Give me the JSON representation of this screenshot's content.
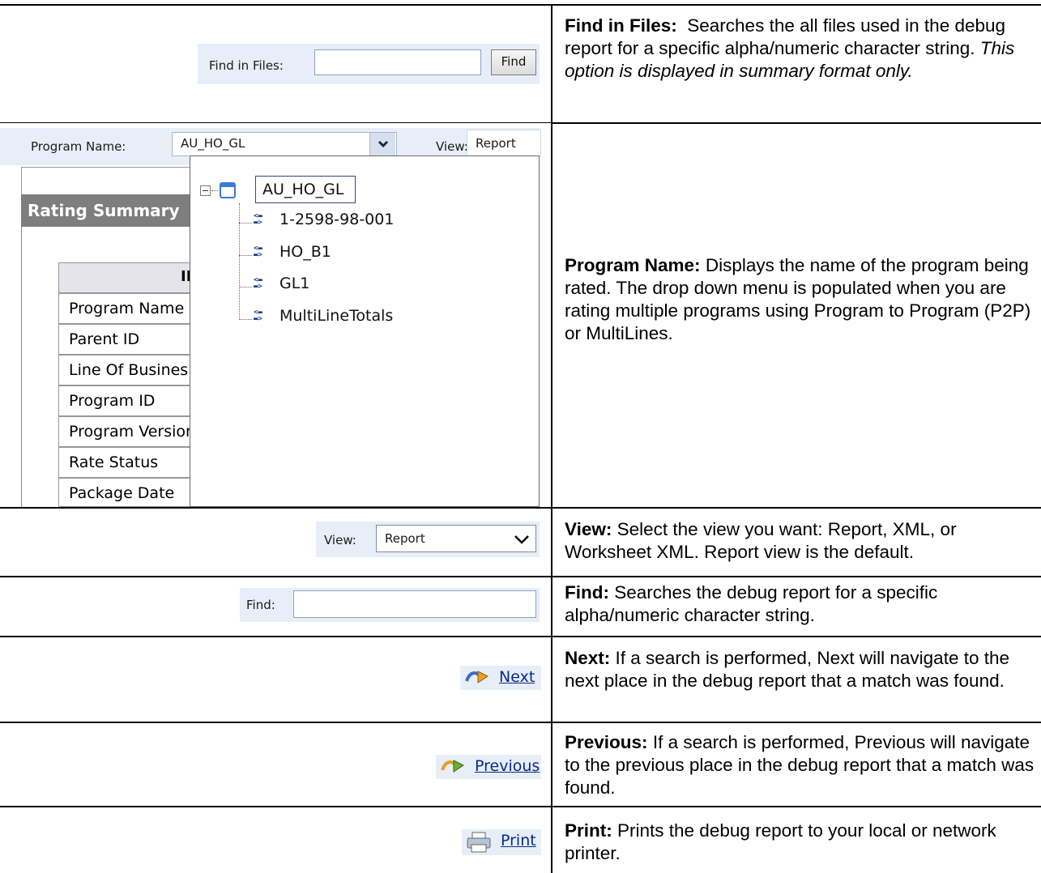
{
  "rows": {
    "find_in_files": {
      "label": "Find in Files:",
      "button": "Find",
      "desc_title": "Find in Files:",
      "desc_body": "Searches the all files used in the debug report for a specific alpha/numeric character string.",
      "desc_note": "This option is displayed in summary format only."
    },
    "program_name": {
      "label": "Program Name:",
      "value": "AU_HO_GL",
      "view_label": "View:",
      "view_value": "Report",
      "rating_summary": "Rating Summary",
      "grid_header_fragment": "II",
      "grid_rows": [
        "Program Name",
        "Parent ID",
        "Line Of Busines",
        "Program ID",
        "Program Versior",
        "Rate Status",
        "Package Date"
      ],
      "tree_root": "AU_HO_GL",
      "tree_children": [
        "1-2598-98-001",
        "HO_B1",
        "GL1",
        "MultiLineTotals"
      ],
      "desc_title": "Program Name:",
      "desc_body": "Displays the name of the program being rated. The drop down menu is populated when you are rating multiple programs using Program to Program (P2P) or MultiLines."
    },
    "view": {
      "label": "View:",
      "value": "Report",
      "desc_title": "View:",
      "desc_body": "Select the view you want: Report, XML, or Worksheet XML. Report view is the default."
    },
    "find": {
      "label": "Find:",
      "desc_title": "Find:",
      "desc_body": "Searches the debug report for a specific alpha/numeric character string."
    },
    "next": {
      "label": "Next",
      "desc_title": "Next:",
      "desc_body": "If a search is performed, Next will navigate to the next place in the debug report that a match was found."
    },
    "previous": {
      "label": "Previous",
      "desc_title": "Previous:",
      "desc_body": "If a search is performed, Previous will navigate to the previous place in the debug report that a match was found."
    },
    "print": {
      "label": "Print",
      "desc_title": "Print:",
      "desc_body": "Prints the debug report to your local or network printer."
    }
  },
  "icons": {
    "next": "next-arrow-icon",
    "previous": "previous-arrow-icon",
    "print": "printer-icon",
    "dropdown": "chevron-down-icon",
    "tree_root": "window-icon",
    "tree_node": "node-icon",
    "collapse": "collapse-minus-icon"
  }
}
